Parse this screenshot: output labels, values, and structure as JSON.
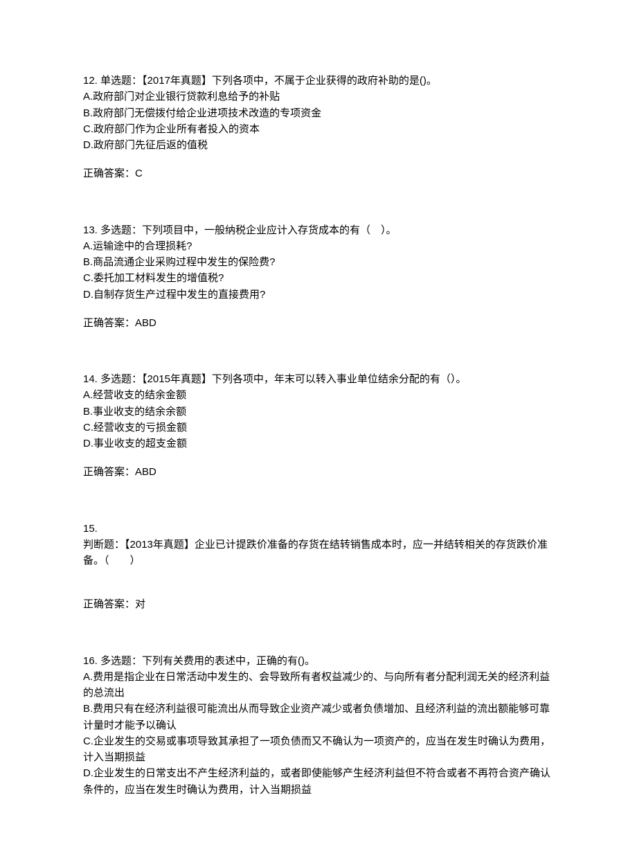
{
  "questions": [
    {
      "num": "12.",
      "type": "单选题：",
      "stem": "【2017年真题】下列各项中，不属于企业获得的政府补助的是()。",
      "options": [
        "A.政府部门对企业银行贷款利息给予的补贴",
        "B.政府部门无偿拨付给企业进项技术改造的专项资金",
        "C.政府部门作为企业所有者投入的资本",
        "D.政府部门先征后返的值税"
      ],
      "answer_label": "正确答案：",
      "answer_value": "C"
    },
    {
      "num": "13.",
      "type": "多选题：",
      "stem": "下列项目中，一般纳税企业应计入存货成本的有（　）。",
      "options": [
        "A.运输途中的合理损耗?",
        "B.商品流通企业采购过程中发生的保险费?",
        "C.委托加工材料发生的增值税?",
        "D.自制存货生产过程中发生的直接费用?"
      ],
      "answer_label": "正确答案：",
      "answer_value": "ABD"
    },
    {
      "num": "14.",
      "type": "多选题：",
      "stem": "【2015年真题】下列各项中，年末可以转入事业单位结余分配的有（）。",
      "options": [
        "A.经营收支的结余金额",
        "B.事业收支的结余余额",
        "C.经营收支的亏损金额",
        "D.事业收支的超支金额"
      ],
      "answer_label": "正确答案：",
      "answer_value": "ABD"
    },
    {
      "num": "15.",
      "type_line": "判断题：",
      "stem": "【2013年真题】企业已计提跌价准备的存货在结转销售成本时，应一并结转相关的存货跌价准备。（　　）",
      "answer_label": "正确答案：",
      "answer_value": "对"
    },
    {
      "num": "16.",
      "type": "多选题：",
      "stem": "下列有关费用的表述中，正确的有()。",
      "options": [
        "A.费用是指企业在日常活动中发生的、会导致所有者权益减少的、与向所有者分配利润无关的经济利益的总流出",
        "B.费用只有在经济利益很可能流出从而导致企业资产减少或者负债增加、且经济利益的流出额能够可靠计量时才能予以确认",
        "C.企业发生的交易或事项导致其承担了一项负债而又不确认为一项资产的，应当在发生时确认为费用，计入当期损益",
        "D.企业发生的日常支出不产生经济利益的，或者即使能够产生经济利益但不符合或者不再符合资产确认条件的，应当在发生时确认为费用，计入当期损益"
      ]
    }
  ]
}
